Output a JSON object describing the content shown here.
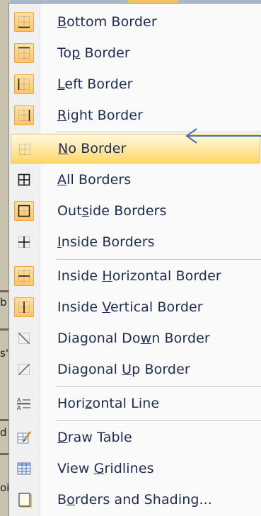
{
  "menu": {
    "items": [
      {
        "pre": "",
        "key": "B",
        "post": "ottom Border",
        "checked": true,
        "icon": "bottom-border-icon"
      },
      {
        "pre": "To",
        "key": "p",
        "post": " Border",
        "checked": true,
        "icon": "top-border-icon"
      },
      {
        "pre": "",
        "key": "L",
        "post": "eft Border",
        "checked": true,
        "icon": "left-border-icon"
      },
      {
        "pre": "",
        "key": "R",
        "post": "ight Border",
        "checked": true,
        "icon": "right-border-icon"
      },
      {
        "pre": "",
        "key": "N",
        "post": "o Border",
        "checked": false,
        "icon": "no-border-icon",
        "hover": true
      },
      {
        "pre": "",
        "key": "A",
        "post": "ll Borders",
        "checked": false,
        "icon": "all-borders-icon"
      },
      {
        "pre": "Out",
        "key": "s",
        "post": "ide Borders",
        "checked": true,
        "icon": "outside-borders-icon"
      },
      {
        "pre": "",
        "key": "I",
        "post": "nside Borders",
        "checked": false,
        "icon": "inside-borders-icon"
      },
      {
        "pre": "Inside ",
        "key": "H",
        "post": "orizontal Border",
        "checked": true,
        "icon": "inside-horizontal-border-icon"
      },
      {
        "pre": "Inside ",
        "key": "V",
        "post": "ertical Border",
        "checked": true,
        "icon": "inside-vertical-border-icon"
      },
      {
        "pre": "Diagonal Do",
        "key": "w",
        "post": "n Border",
        "checked": false,
        "icon": "diagonal-down-border-icon"
      },
      {
        "pre": "Diagonal ",
        "key": "U",
        "post": "p Border",
        "checked": false,
        "icon": "diagonal-up-border-icon"
      },
      {
        "pre": "Hori",
        "key": "z",
        "post": "ontal Line",
        "checked": false,
        "icon": "horizontal-line-icon"
      },
      {
        "pre": "",
        "key": "D",
        "post": "raw Table",
        "checked": false,
        "icon": "draw-table-icon"
      },
      {
        "pre": "View ",
        "key": "G",
        "post": "ridlines",
        "checked": false,
        "icon": "view-gridlines-icon"
      },
      {
        "pre": "B",
        "key": "o",
        "post": "rders and Shading...",
        "checked": false,
        "icon": "borders-and-shading-icon"
      }
    ]
  },
  "background": {
    "marks": [
      "b",
      "s'",
      "d",
      "oi"
    ]
  },
  "colors": {
    "accent_hover": "#ffe7a0",
    "checked_border": "#f0a73a",
    "arrow": "#4a6fb5",
    "text": "#1e2a56"
  }
}
